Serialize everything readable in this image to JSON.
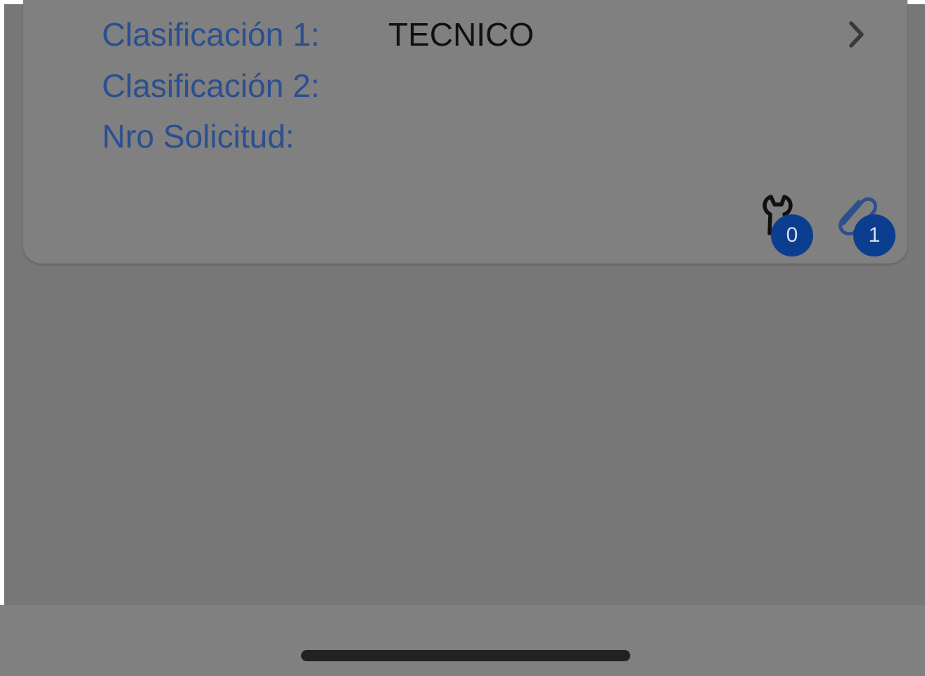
{
  "details_card": {
    "rows": [
      {
        "label": "Clasificación 1:",
        "value": "TECNICO"
      },
      {
        "label": "Clasificación 2:",
        "value": ""
      },
      {
        "label": "Nro Solicitud:",
        "value": ""
      }
    ],
    "action_icon": "chevron-right-icon",
    "counters": [
      {
        "icon": "wrench-icon",
        "count": "0"
      },
      {
        "icon": "paperclip-icon",
        "count": "1"
      }
    ]
  },
  "colors": {
    "label": "#2b4f90",
    "value": "#111111",
    "badge": "#0c3e8f",
    "overlay": "#777777"
  }
}
